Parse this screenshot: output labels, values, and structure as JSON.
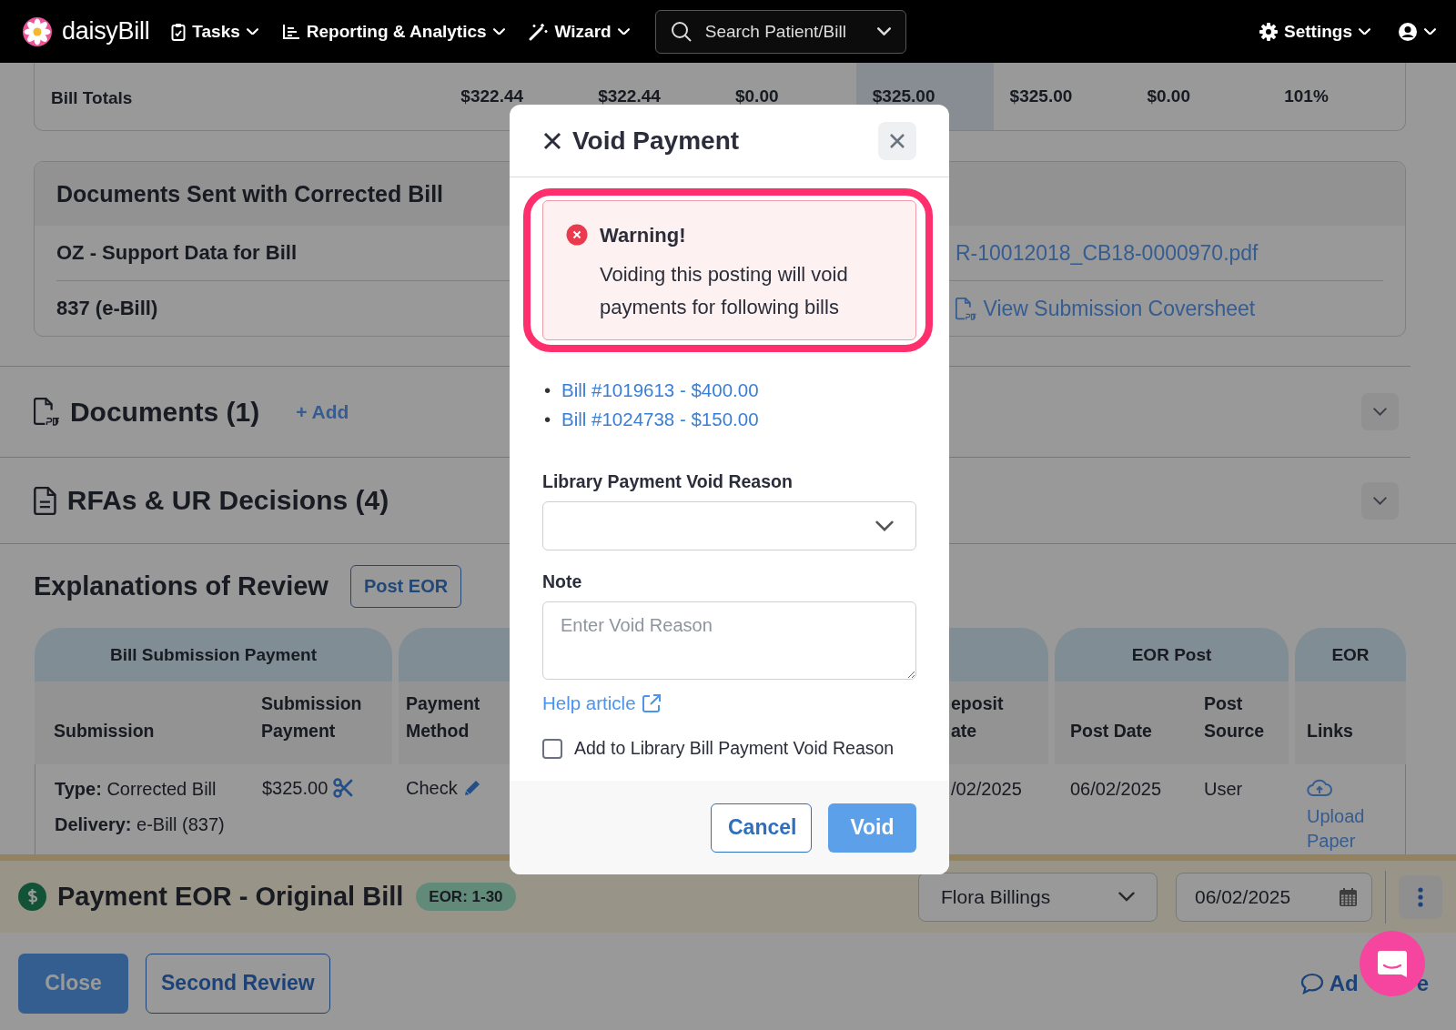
{
  "navbar": {
    "brand": "daisyBill",
    "menus": [
      {
        "label": "Tasks"
      },
      {
        "label": "Reporting & Analytics"
      },
      {
        "label": "Wizard"
      }
    ],
    "search": {
      "placeholder": "Search Patient/Bill"
    },
    "settings": "Settings"
  },
  "bill_totals": {
    "label": "Bill Totals",
    "values": [
      {
        "text": "$322.44",
        "highlighted": false
      },
      {
        "text": "$322.44",
        "highlighted": false
      },
      {
        "text": "$0.00",
        "highlighted": false
      },
      {
        "text": "$325.00",
        "highlighted": true
      },
      {
        "text": "$325.00",
        "highlighted": false
      },
      {
        "text": "$0.00",
        "highlighted": false
      },
      {
        "text": "101%",
        "highlighted": false
      }
    ]
  },
  "documents_sent": {
    "title": "Documents Sent with Corrected Bill",
    "rows": [
      {
        "name": "OZ - Support Data for Bill",
        "link": "R-10012018_CB18-0000970.pdf"
      },
      {
        "name": "837 (e-Bill)",
        "link": "View Submission Coversheet"
      }
    ]
  },
  "sections": [
    {
      "title": "Documents (1)",
      "add_label": "+ Add"
    },
    {
      "title": "RFAs & UR Decisions (4)"
    }
  ],
  "eor": {
    "title": "Explanations of Review",
    "post_button": "Post EOR",
    "groups": [
      {
        "label": "Bill Submission Payment",
        "columns": [
          "Submission",
          "Submission Payment"
        ]
      },
      {
        "columns": [
          "Payment Method",
          "eposit ate"
        ]
      },
      {
        "label": "EOR Post",
        "columns": [
          "Post Date",
          "Post Source"
        ]
      },
      {
        "label": "EOR",
        "columns": [
          "Links"
        ]
      }
    ],
    "row": [
      {
        "lines": [
          "**Type:** Corrected Bill",
          "**Delivery:** e-Bill (837)"
        ]
      },
      {
        "text": "$325.00"
      },
      {
        "text": "Check"
      },
      {
        "text": "/02/2025"
      },
      {
        "text": "06/02/2025"
      },
      {
        "text": "User"
      },
      {
        "text": "Upload Paper"
      }
    ]
  },
  "payment_bar": {
    "title": "Payment EOR - Original Bill",
    "badge": "EOR: 1-30",
    "assignee": "Flora Billings",
    "date": "06/02/2025"
  },
  "footer": {
    "buttons": [
      {
        "label": "Close",
        "kind": "primary"
      },
      {
        "label": "Second Review",
        "kind": "outline"
      }
    ],
    "note_link": {
      "before": "Ad",
      "after": "e"
    }
  },
  "modal": {
    "title": "Void Payment",
    "warning": {
      "title": "Warning!",
      "message": "Voiding this posting will void payments for following bills",
      "highlighted": true
    },
    "bills": [
      {
        "bullet": "•",
        "label": "Bill #1019613 - $400.00"
      },
      {
        "bullet": "•",
        "label": "Bill #1024738 - $150.00"
      }
    ],
    "reason_label": "Library Payment Void Reason",
    "note": {
      "label": "Note",
      "placeholder": "Enter Void Reason"
    },
    "help_link": "Help article",
    "add_to_library": {
      "label": "Add to Library Bill Payment Void Reason",
      "checked": false
    },
    "buttons": [
      {
        "label": "Cancel",
        "kind": "outline"
      },
      {
        "label": "Void",
        "kind": "primary"
      }
    ]
  }
}
